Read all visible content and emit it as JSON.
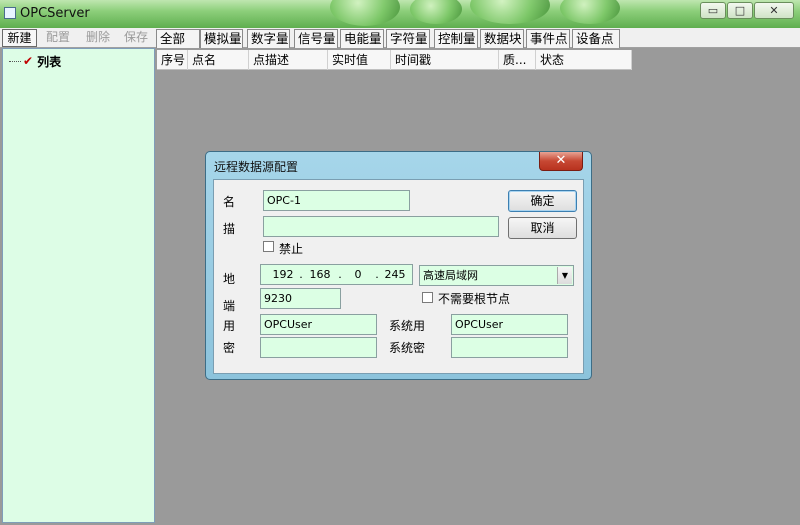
{
  "window": {
    "title": "OPCServer",
    "minimize": "▭",
    "maximize": "□",
    "close": "✕"
  },
  "toolbar": {
    "buttons": [
      {
        "label": "新建",
        "enabled": true
      },
      {
        "label": "配置",
        "enabled": false
      },
      {
        "label": "删除",
        "enabled": false
      },
      {
        "label": "保存",
        "enabled": false
      }
    ],
    "tabs": [
      "全部",
      "模拟量",
      "数字量",
      "信号量",
      "电能量",
      "字符量",
      "控制量",
      "数据块",
      "事件点",
      "设备点"
    ]
  },
  "tree": {
    "root_label": "列表"
  },
  "grid": {
    "columns": [
      "序号",
      "点名",
      "点描述",
      "实时值",
      "时间戳",
      "质...",
      "状态"
    ]
  },
  "dialog": {
    "title": "远程数据源配置",
    "close": "✕",
    "labels": {
      "name": "名",
      "desc": "描",
      "addr": "地",
      "port": "端",
      "user": "用",
      "pwd": "密",
      "sys_user": "系统用",
      "sys_pwd": "系统密"
    },
    "fields": {
      "name": "OPC-1",
      "desc": "",
      "ip": [
        "192",
        "168",
        "0",
        "245"
      ],
      "network": "高速局域网",
      "port": "9230",
      "user": "OPCUser",
      "pwd": "",
      "sys_user": "OPCUser",
      "sys_pwd": ""
    },
    "checks": {
      "disable": "禁止",
      "no_root": "不需要根节点"
    },
    "buttons": {
      "ok": "确定",
      "cancel": "取消"
    }
  }
}
